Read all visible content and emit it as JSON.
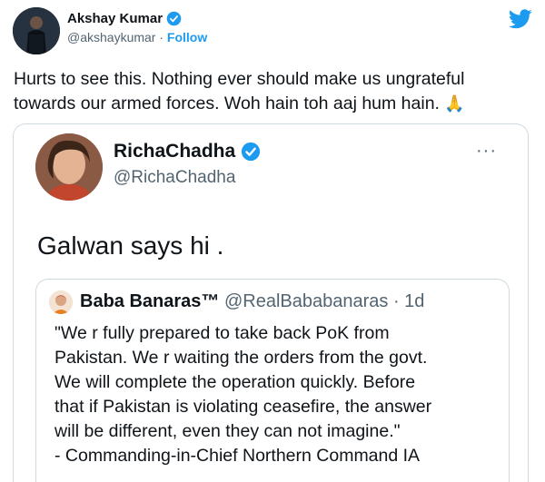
{
  "tweet": {
    "author_name": "Akshay Kumar",
    "handle": "@akshaykumar",
    "separator": " · ",
    "follow_label": "Follow",
    "text": "Hurts to see this. Nothing ever should make us ungrateful towards our armed forces. Woh hain toh aaj hum hain.",
    "emoji": "🙏"
  },
  "quoted": {
    "author_name": "RichaChadha",
    "handle": "@RichaChadha",
    "more_label": "···",
    "text": "Galwan says hi ."
  },
  "nested_quote": {
    "author_name": "Baba Banaras™",
    "handle": "@RealBababanaras",
    "time": " · 1d",
    "text_lines": [
      "\"We r fully prepared to take back PoK from",
      "Pakistan. We r waiting the orders from the govt.",
      "We will complete the operation quickly. Before",
      "that if Pakistan is violating ceasefire, the answer",
      "will be different, even they can not imagine.\"",
      "- Commanding-in-Chief Northern Command IA"
    ]
  },
  "colors": {
    "accent": "#1d9bf0",
    "text": "#0f1419",
    "muted": "#536471",
    "border": "#cfd9de"
  },
  "icons": [
    "twitter-bird-icon",
    "verified-badge-icon",
    "more-options-icon"
  ]
}
